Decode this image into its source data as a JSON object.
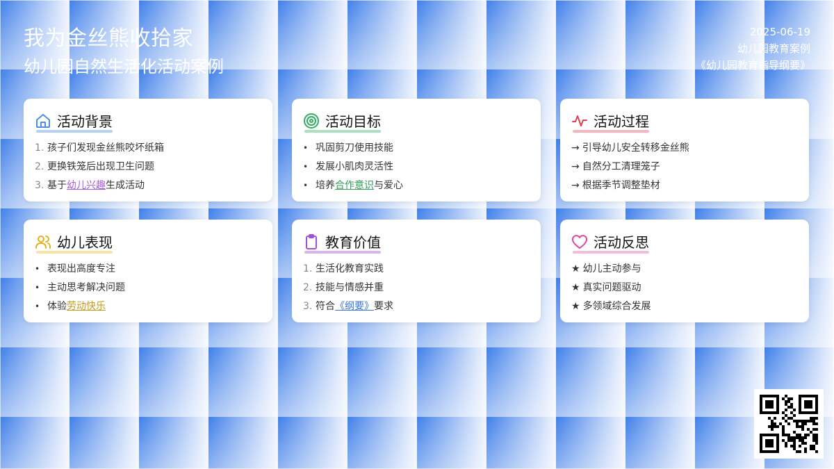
{
  "header": {
    "title": "我为金丝熊收拾家",
    "subtitle": "幼儿园自然生活化活动案例",
    "date": "2025-06-19",
    "category": "幼儿园教育案例",
    "reference": "《幼儿园教育指导纲要》"
  },
  "cards": [
    {
      "title": "活动背景",
      "icon": "home-icon",
      "items": [
        {
          "marker": "1.",
          "before": "孩子们发现金丝熊咬坏纸箱",
          "highlight": "",
          "after": ""
        },
        {
          "marker": "2.",
          "before": "更换铁笼后出现卫生问题",
          "highlight": "",
          "after": ""
        },
        {
          "marker": "3.",
          "before": "基于",
          "highlight": "幼儿兴趣",
          "after": "生成活动"
        }
      ]
    },
    {
      "title": "活动目标",
      "icon": "target-icon",
      "items": [
        {
          "marker": "•",
          "before": "巩固剪刀使用技能",
          "highlight": "",
          "after": ""
        },
        {
          "marker": "•",
          "before": "发展小肌肉灵活性",
          "highlight": "",
          "after": ""
        },
        {
          "marker": "•",
          "before": "培养",
          "highlight": "合作意识",
          "after": "与爱心"
        }
      ]
    },
    {
      "title": "活动过程",
      "icon": "activity-icon",
      "items": [
        {
          "marker": "→",
          "before": "引导幼儿安全转移金丝熊",
          "highlight": "",
          "after": ""
        },
        {
          "marker": "→",
          "before": "自然分工清理笼子",
          "highlight": "",
          "after": ""
        },
        {
          "marker": "→",
          "before": "根据季节调整垫材",
          "highlight": "",
          "after": ""
        }
      ]
    },
    {
      "title": "幼儿表现",
      "icon": "users-icon",
      "items": [
        {
          "marker": "•",
          "before": "表现出高度专注",
          "highlight": "",
          "after": ""
        },
        {
          "marker": "•",
          "before": "主动思考解决问题",
          "highlight": "",
          "after": ""
        },
        {
          "marker": "•",
          "before": "体验",
          "highlight": "劳动快乐",
          "after": ""
        }
      ]
    },
    {
      "title": "教育价值",
      "icon": "clipboard-icon",
      "items": [
        {
          "marker": "1.",
          "before": "生活化教育实践",
          "highlight": "",
          "after": ""
        },
        {
          "marker": "2.",
          "before": "技能与情感并重",
          "highlight": "",
          "after": ""
        },
        {
          "marker": "3.",
          "before": "符合",
          "highlight": "《纲要》",
          "after": "要求"
        }
      ]
    },
    {
      "title": "活动反思",
      "icon": "heart-icon",
      "items": [
        {
          "marker": "★",
          "before": "幼儿主动参与",
          "highlight": "",
          "after": ""
        },
        {
          "marker": "★",
          "before": "真实问题驱动",
          "highlight": "",
          "after": ""
        },
        {
          "marker": "★",
          "before": "多领域综合发展",
          "highlight": "",
          "after": ""
        }
      ]
    }
  ],
  "colors": {
    "background": "#3f7fea",
    "blue": "#5b9be8",
    "green": "#3fbf6e",
    "red": "#e85b6b",
    "yellow": "#e8c23b",
    "purple": "#a45be0",
    "pink": "#e86bb5"
  }
}
